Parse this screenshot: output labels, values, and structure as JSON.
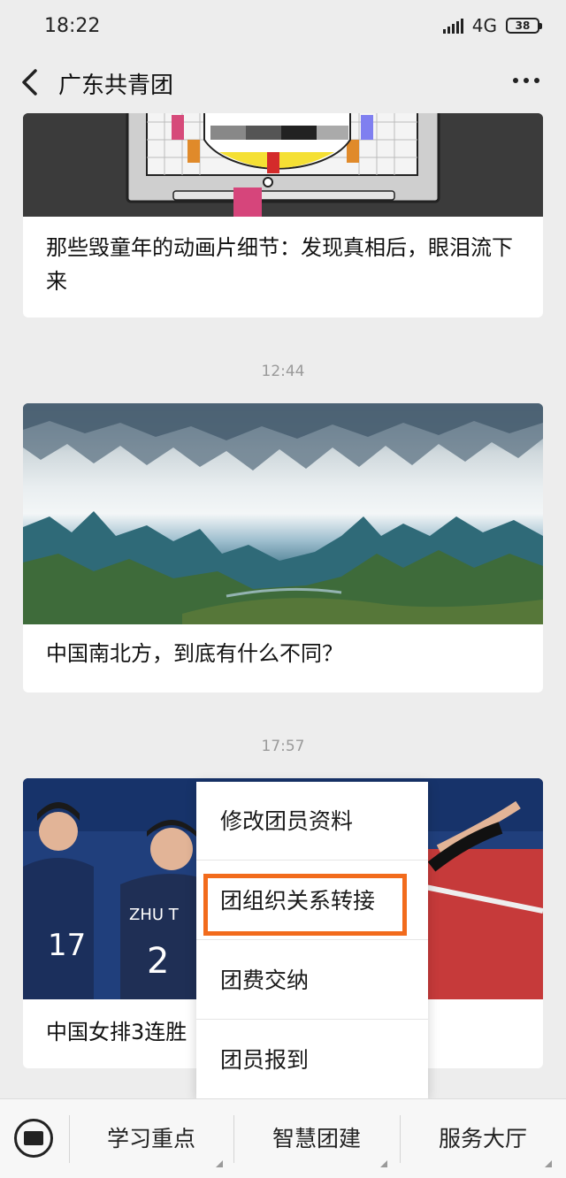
{
  "status_bar": {
    "time": "18:22",
    "network": "4G",
    "battery": "38"
  },
  "nav": {
    "title": "广东共青团"
  },
  "feed": {
    "articles": [
      {
        "title": "那些毁童年的动画片细节：发现真相后，眼泪流下来"
      },
      {
        "timestamp": "12:44",
        "title": "中国南北方，到底有什么不同？"
      },
      {
        "timestamp": "17:57",
        "title": "中国女排3连胜"
      }
    ]
  },
  "popup_menu": {
    "items": [
      {
        "label": "修改团员资料"
      },
      {
        "label": "团组织关系转接"
      },
      {
        "label": "团费交纳"
      },
      {
        "label": "团员报到"
      }
    ],
    "highlight_color": "#f26b1c"
  },
  "bottom_menu": {
    "items": [
      {
        "label": "学习重点"
      },
      {
        "label": "智慧团建"
      },
      {
        "label": "服务大厅"
      }
    ]
  }
}
